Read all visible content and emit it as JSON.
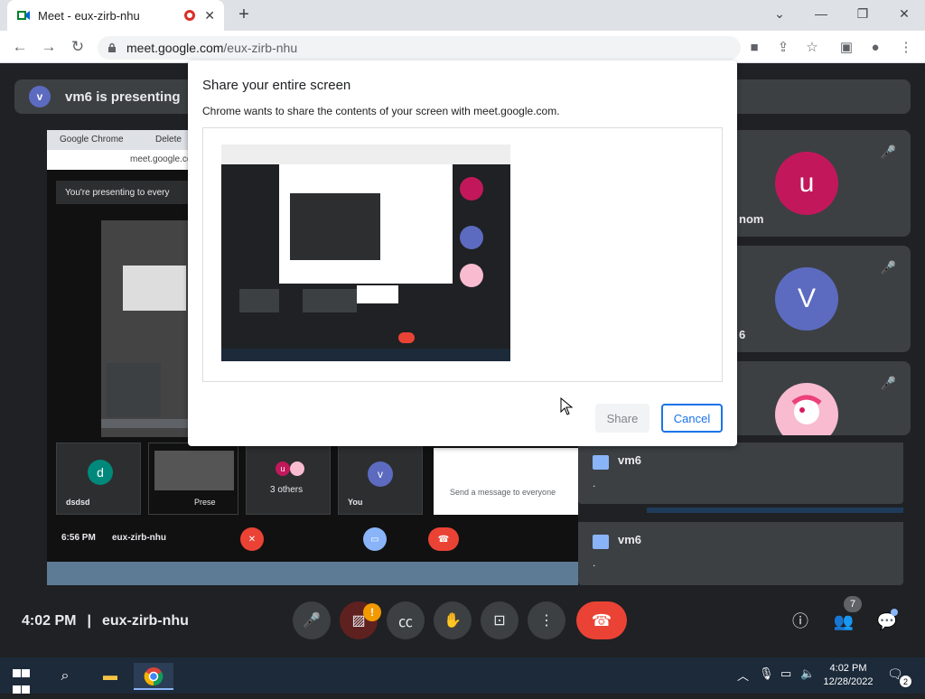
{
  "browser": {
    "tab_title": "Meet - eux-zirb-nhu",
    "new_tab": "+",
    "window_controls": {
      "chevron": "⌄",
      "minimize": "—",
      "restore": "❐",
      "close": "✕"
    },
    "url_host": "meet.google.com",
    "url_path": "/eux-zirb-nhu"
  },
  "meet": {
    "presenting_banner": {
      "avatar": "v",
      "text": "vm6 is presenting"
    },
    "shared_screen": {
      "tab1": "Google Chrome",
      "tab2": "Delete",
      "url": "meet.google.co",
      "banner": "You're presenting to every",
      "small_tiles": [
        {
          "avatar": "d",
          "name": "dsdsd"
        },
        {
          "avatar": "",
          "name": "Prese"
        },
        {
          "avatar": "",
          "name": "3 others"
        },
        {
          "avatar": "v",
          "name": "You"
        }
      ],
      "chat_placeholder": "Send a message to everyone",
      "time": "6:56 PM",
      "meeting": "eux-zirb-nhu"
    },
    "participants": [
      {
        "avatar": "u",
        "name_fragment": "nom",
        "color": "#c2185b"
      },
      {
        "avatar": "V",
        "name_fragment": "6",
        "color": "#5c6bc0"
      },
      {
        "avatar": "",
        "name_fragment": "",
        "color": "#f8bbd0"
      }
    ],
    "chat_toasts": [
      {
        "name": "vm6",
        "message": "."
      },
      {
        "name": "vm6",
        "message": "."
      }
    ],
    "bottom": {
      "time": "4:02 PM",
      "separator": "|",
      "meeting_code": "eux-zirb-nhu",
      "people_count": "7",
      "warning": "!"
    }
  },
  "dialog": {
    "title": "Share your entire screen",
    "subtitle": "Chrome wants to share the contents of your screen with meet.google.com.",
    "share_label": "Share",
    "cancel_label": "Cancel"
  },
  "taskbar": {
    "time": "4:02 PM",
    "date": "12/28/2022",
    "notifications": "2"
  },
  "colors": {
    "meet_bg": "#202124",
    "tile_bg": "#3c4043",
    "end_call": "#ea4335",
    "accent": "#1a73e8"
  }
}
